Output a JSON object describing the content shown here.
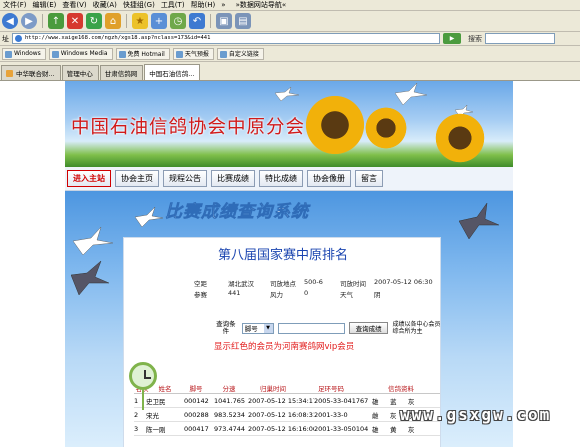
{
  "browser": {
    "menu": [
      "文件(F)",
      "编辑(E)",
      "查看(V)",
      "收藏(A)",
      "快捷组(G)",
      "工具(T)",
      "帮助(H)"
    ],
    "menu_extra": "»",
    "menu_right": "»数据网站导航«",
    "address": "http://www.xaige168.com/ngzh/xgs18.asp?nclass=173&id=441",
    "address_label": "址",
    "search_label": "搜索",
    "links": [
      "Windows",
      "Windows Media",
      "免费 Hotmail",
      "天气预报",
      "自定义链接"
    ],
    "tabs": [
      "中华联合财...",
      "管理中心",
      "甘肃信鸽网",
      "中国石油信鸽..."
    ]
  },
  "banner": {
    "title": "中国石油信鸽协会中原分会"
  },
  "nav": [
    "进入主站",
    "协会主页",
    "规程公告",
    "比赛成绩",
    "特比成绩",
    "协会像册",
    "留言"
  ],
  "system_title": "比赛成绩查询系统",
  "page": {
    "title": "第八届国家赛中原排名",
    "info": [
      [
        "空距",
        "湖北武汉",
        "司放地点",
        "500-6",
        "司放时间",
        "2007-05-12 06:30"
      ],
      [
        "参赛",
        "441",
        "风力",
        "0",
        "天气",
        "阴"
      ]
    ],
    "query": {
      "label": "查询条件",
      "select_value": "脚号",
      "button": "查询成绩",
      "note": "成绩以各中心会员综合所为主"
    },
    "vip_note": "显示红色的会员为河南赛鸽网vip会员",
    "table": {
      "headers": [
        "名次",
        "姓名",
        "脚号",
        "分速",
        "归巢时间",
        "足环号码",
        "信鸽资料"
      ],
      "rows": [
        [
          "1",
          "史卫民",
          "000142",
          "1041.765",
          "2007-05-12 15:34:17",
          "2005-33-041767",
          "雄",
          "蓝",
          "灰"
        ],
        [
          "2",
          "宋光",
          "000288",
          "983.5234",
          "2007-05-12 16:08:31",
          "2001-33-0",
          "雌",
          "灰",
          "灰"
        ],
        [
          "3",
          "陈一刚",
          "000417",
          "973.4744",
          "2007-05-12 16:16:00",
          "2001-33-050104",
          "雄",
          "黄",
          "灰"
        ]
      ]
    }
  },
  "watermark": "www.gsxgw.com",
  "colors": {
    "title_red": "#d11a1a",
    "rank_blue": "#1b45b0",
    "vip_red": "#e21b1b"
  }
}
